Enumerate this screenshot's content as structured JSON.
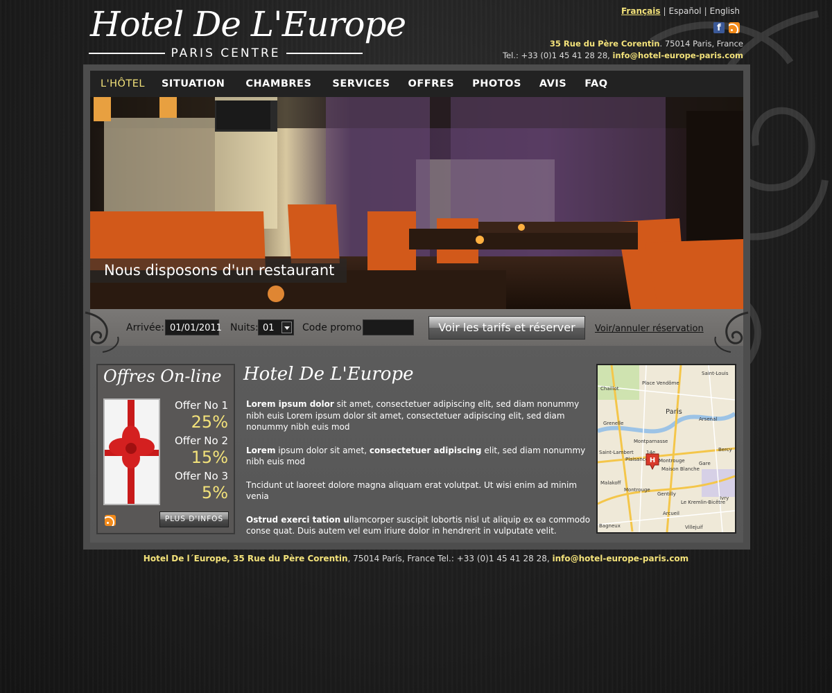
{
  "header": {
    "logo_title": "Hotel De L'Europe",
    "logo_subtitle": "PARIS CENTRE",
    "languages": [
      "Français",
      "Español",
      "English"
    ],
    "address_street": "35 Rue du Père Corentin",
    "address_city": ". 75014 Paris, France",
    "phone": "Tel.: +33 (0)1 45 41 28 28, ",
    "email": "info@hotel-europe-paris.com"
  },
  "nav": {
    "items": [
      "L'HÔTEL",
      "SITUATION",
      "CHAMBRES",
      "SERVICES",
      "OFFRES",
      "PHOTOS",
      "AVIS",
      "FAQ"
    ],
    "active_index": 0
  },
  "hero": {
    "caption": "Nous disposons d'un restaurant"
  },
  "booking": {
    "arrival_label": "Arrivée:",
    "arrival_value": "01/01/2011",
    "nights_label": "Nuits:",
    "nights_value": "01",
    "promo_label": "Code promo:",
    "promo_value": "",
    "cta_label": "Voir les tarifs et réserver",
    "manage_label": "Voir/annuler réservation"
  },
  "offers": {
    "title": "Offres On-line",
    "items": [
      {
        "name": "Offer No 1",
        "discount": "25%"
      },
      {
        "name": "Offer No 2",
        "discount": "15%"
      },
      {
        "name": "Offer No 3",
        "discount": "5%"
      }
    ],
    "more_label": "PLUS D'INFOS"
  },
  "intro": {
    "title": "Hotel De L'Europe",
    "p1_bold": "Lorem ipsum dolor",
    "p1_text": " sit amet, consectetuer adipiscing elit, sed diam nonummy nibh euis Lorem ipsum dolor sit amet, consectetuer adipiscing elit, sed diam nonummy nibh euis mod",
    "p2_bold1": "Lorem",
    "p2_text1": " ipsum dolor sit amet, ",
    "p2_bold2": "consectetuer adipiscing",
    "p2_text2": " elit, sed diam nonummy nibh euis mod",
    "p3_text": "Tncidunt ut laoreet dolore magna aliquam erat volutpat. Ut wisi enim ad minim venia",
    "p4_bold": "Ostrud exerci tation u",
    "p4_text": "llamcorper suscipit lobortis nisl ut aliquip ex ea commodo conse quat. Duis autem vel eum iriure dolor in hendrerit in vulputate velit."
  },
  "map": {
    "labels": [
      "Place Vendôme",
      "Saint-Louis",
      "Chaillot",
      "Paris",
      "Grenelle",
      "Arsenal",
      "Montparnasse",
      "Saint-Lambert",
      "Plaisance",
      "14e",
      "Montrouge",
      "Maison Blanche",
      "Gare",
      "Bercy",
      "Malakoff",
      "Montrouge",
      "Gentilly",
      "Le Kremlin-Bicêtre",
      "Arcueil",
      "Bagneux",
      "Ivry",
      "Villejuif"
    ],
    "marker": "H"
  },
  "footer": {
    "name_address": "Hotel De l´Europe, 35 Rue du Père Corentin",
    "rest": ", 75014 París, France Tel.: +33 (0)1 45 41 28 28, ",
    "email": "info@hotel-europe-paris.com"
  },
  "colors": {
    "accent": "#f3e27a",
    "background": "#1c1c1c",
    "nav_bg": "#222222",
    "facebook": "#3b5998",
    "rss": "#f28a1a"
  },
  "icons": [
    "facebook-icon",
    "rss-icon",
    "dropdown-arrow-icon",
    "map-marker-icon"
  ]
}
